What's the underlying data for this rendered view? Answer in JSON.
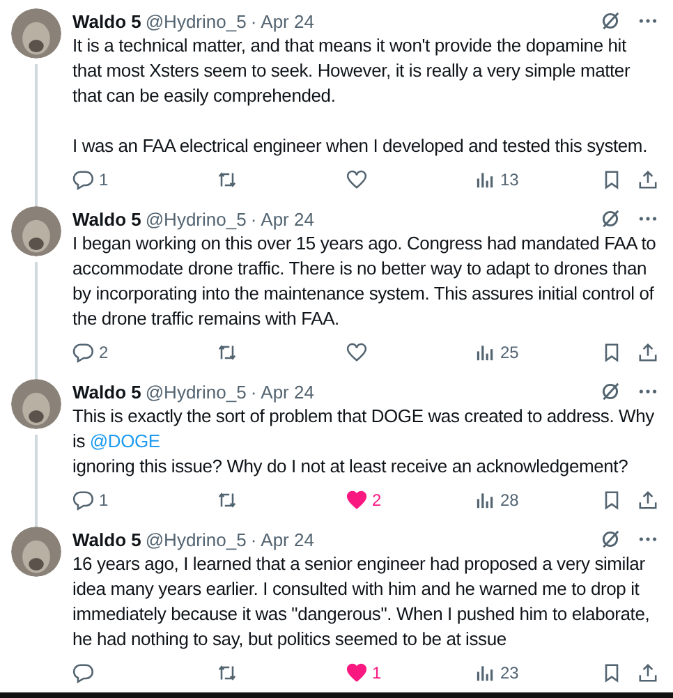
{
  "posts": [
    {
      "author": "Waldo 5",
      "handle": "@Hydrino_5",
      "separator": "·",
      "date": "Apr 24",
      "paragraphs": [
        [
          [
            {
              "kind": "text",
              "text": "It is a technical matter, and that means it won't provide the dopamine hit that most Xsters seem to seek.  However, it is really a very simple matter that can be easily comprehended."
            }
          ]
        ],
        [
          [
            {
              "kind": "text",
              "text": "I was an FAA electrical engineer when I developed and tested this system."
            }
          ]
        ]
      ],
      "replies": "1",
      "liked": false,
      "views": "13"
    },
    {
      "author": "Waldo 5",
      "handle": "@Hydrino_5",
      "separator": "·",
      "date": "Apr 24",
      "paragraphs": [
        [
          [
            {
              "kind": "text",
              "text": "I began working on this over 15 years ago.  Congress had mandated FAA to accommodate drone traffic.   There is no better way to adapt to drones than by incorporating into the maintenance system.  This assures initial control of the drone traffic remains with FAA."
            }
          ]
        ]
      ],
      "replies": "2",
      "liked": false,
      "views": "25"
    },
    {
      "author": "Waldo 5",
      "handle": "@Hydrino_5",
      "separator": "·",
      "date": "Apr 24",
      "paragraphs": [
        [
          [
            {
              "kind": "text",
              "text": "This is exactly the sort of problem that DOGE was created to address.  Why is "
            },
            {
              "kind": "link",
              "text": "@DOGE"
            }
          ],
          [
            {
              "kind": "text",
              "text": "ignoring this issue?  Why do I not at least receive an acknowledgement?"
            }
          ]
        ]
      ],
      "replies": "1",
      "likes": "2",
      "liked": true,
      "views": "28"
    },
    {
      "author": "Waldo 5",
      "handle": "@Hydrino_5",
      "separator": "·",
      "date": "Apr 24",
      "paragraphs": [
        [
          [
            {
              "kind": "text",
              "text": "16 years ago, I learned that a senior engineer had proposed a very similar idea many years earlier.  I consulted with him and he warned me to drop it immediately because it was \"dangerous\".  When I pushed him to elaborate, he had nothing to say, but politics seemed to be at issue"
            }
          ]
        ]
      ],
      "likes": "1",
      "liked": true,
      "views": "23"
    }
  ]
}
